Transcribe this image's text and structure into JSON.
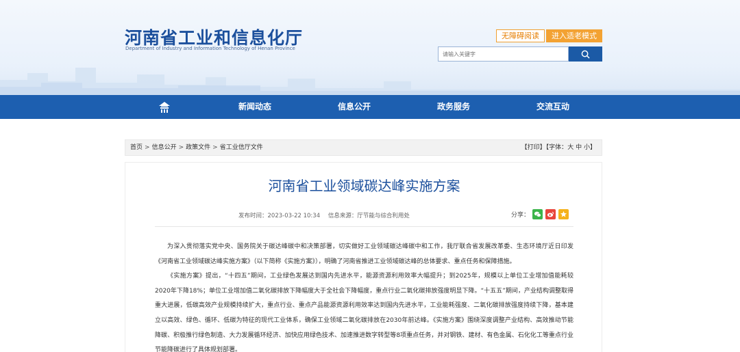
{
  "header": {
    "title": "河南省工业和信息化厅",
    "subtitle": "Department of Industry and Information Technology of Henan Province",
    "accessible_label": "无障碍阅读",
    "elder_mode_label": "进入适老模式",
    "search_placeholder": "请输入关键字",
    "brand_color": "#1b4f9c",
    "accent_color": "#f3a233"
  },
  "nav": {
    "home_icon": "home-icon",
    "items": [
      "新闻动态",
      "信息公开",
      "政务服务",
      "交流互动"
    ],
    "bg_color": "#1d5fb0"
  },
  "breadcrumb": {
    "items": [
      "首页",
      "信息公开",
      "政策文件",
      "省工业信厅文件"
    ],
    "separator": ">"
  },
  "tools": {
    "print": "【打印】",
    "font_prefix": "【字体：",
    "font_large": "大",
    "font_medium": "中",
    "font_small": "小",
    "font_suffix": "】"
  },
  "article": {
    "title": "河南省工业领域碳达峰实施方案",
    "publish_time": "发布时间：2023-03-22 10:34",
    "source": "信息来源：厅节能与综合利用处",
    "share_label": "分享：",
    "share_icons": [
      "wechat-icon",
      "weibo-icon",
      "qzone-icon"
    ],
    "paragraphs": [
      "为深入贯彻落实党中央、国务院关于碳达峰碳中和决策部署，切实做好工业领域碳达峰碳中和工作，我厅联合省发展改革委、生态环境厅近日印发《河南省工业领域碳达峰实施方案》（以下简称《实施方案》），明确了河南省推进工业领域碳达峰的总体要求、重点任务和保障措施。",
      "《实施方案》提出，“十四五”期间，工业绿色发展达到国内先进水平，能源资源利用效率大幅提升；到2025年，规模以上单位工业增加值能耗较2020年下降18%；单位工业增加值二氧化碳排放下降幅度大于全社会下降幅度，重点行业二氧化碳排放强度明显下降。“十五五”期间，产业结构调整取得重大进展，低碳高效产业规模持续扩大，重点行业、重点产品能源资源利用效率达到国内先进水平，工业能耗强度、二氧化碳排放强度持续下降，基本建立以高效、绿色、循环、低碳为特征的现代工业体系，确保工业领域二氧化碳排放在2030年前达峰。《实施方案》围绕深度调整产业结构、高效推动节能降碳、积极推行绿色制造、大力发展循环经济、加快应用绿色技术、加速推进数字转型等8项重点任务，并对钢铁、建材、有色金属、石化化工等重点行业节能降碳进行了具体规划部署。"
    ]
  }
}
